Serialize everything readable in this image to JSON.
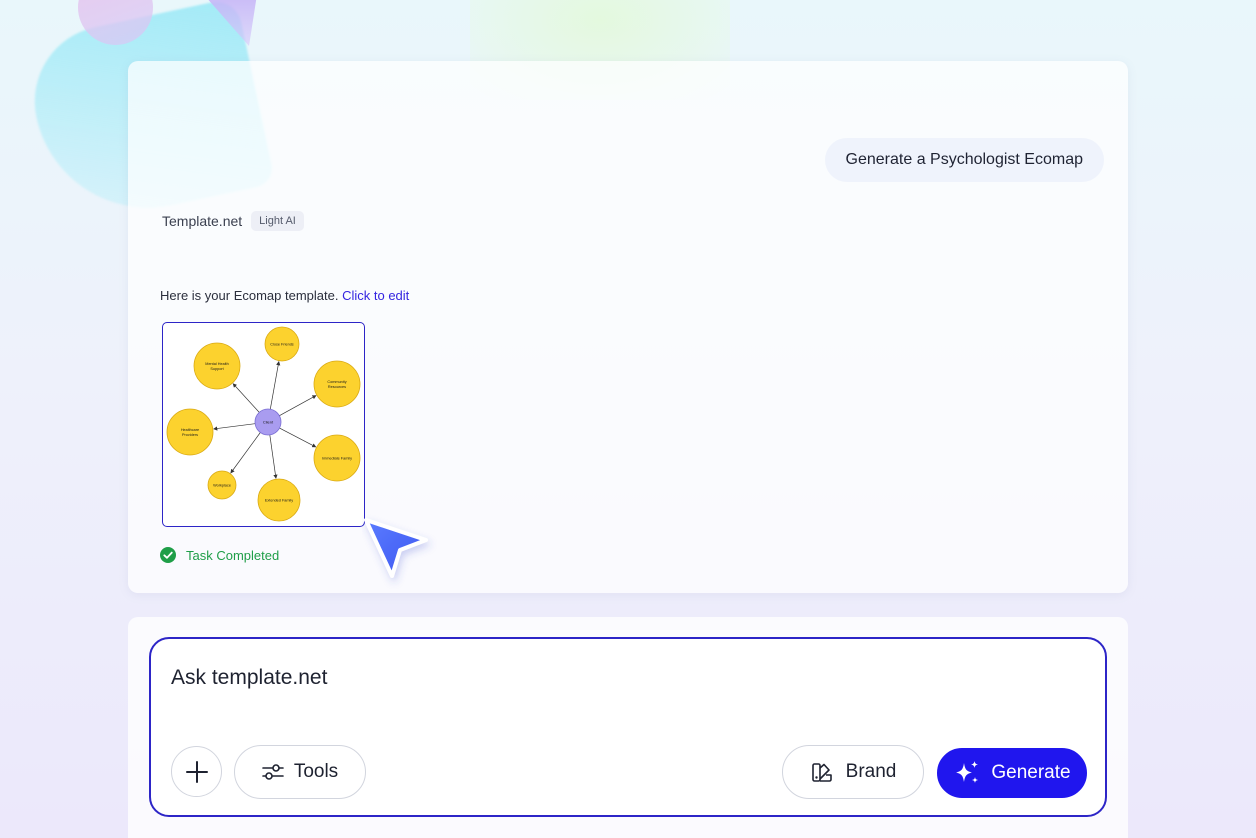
{
  "conversation": {
    "user_message": "Generate a Psychologist Ecomap",
    "assistant": {
      "name": "Template.net",
      "model_badge": "Light AI",
      "response_text": "Here is your Ecomap template.",
      "response_link": "Click to edit"
    },
    "template_preview": {
      "center": "Client",
      "nodes": [
        {
          "label_lines": [
            "Mental Health",
            "Support"
          ]
        },
        {
          "label_lines": [
            "Close Friends"
          ]
        },
        {
          "label_lines": [
            "Community",
            "Resources"
          ]
        },
        {
          "label_lines": [
            "Healthcare",
            "Providers"
          ]
        },
        {
          "label_lines": [
            "Immediate Family"
          ]
        },
        {
          "label_lines": [
            "Workplace"
          ]
        },
        {
          "label_lines": [
            "Extended Family"
          ]
        }
      ],
      "colors": {
        "node_fill": "#fcd22e",
        "node_stroke": "#d9a912",
        "center_fill": "#a99cf0",
        "center_stroke": "#7b6fd4",
        "edge": "#333333"
      }
    },
    "task_status": "Task Completed"
  },
  "composer": {
    "placeholder": "Ask template.net",
    "tools_label": "Tools",
    "brand_label": "Brand",
    "generate_label": "Generate"
  },
  "colors": {
    "accent": "#2016ee",
    "success": "#1f9e48",
    "link": "#3324e0"
  }
}
